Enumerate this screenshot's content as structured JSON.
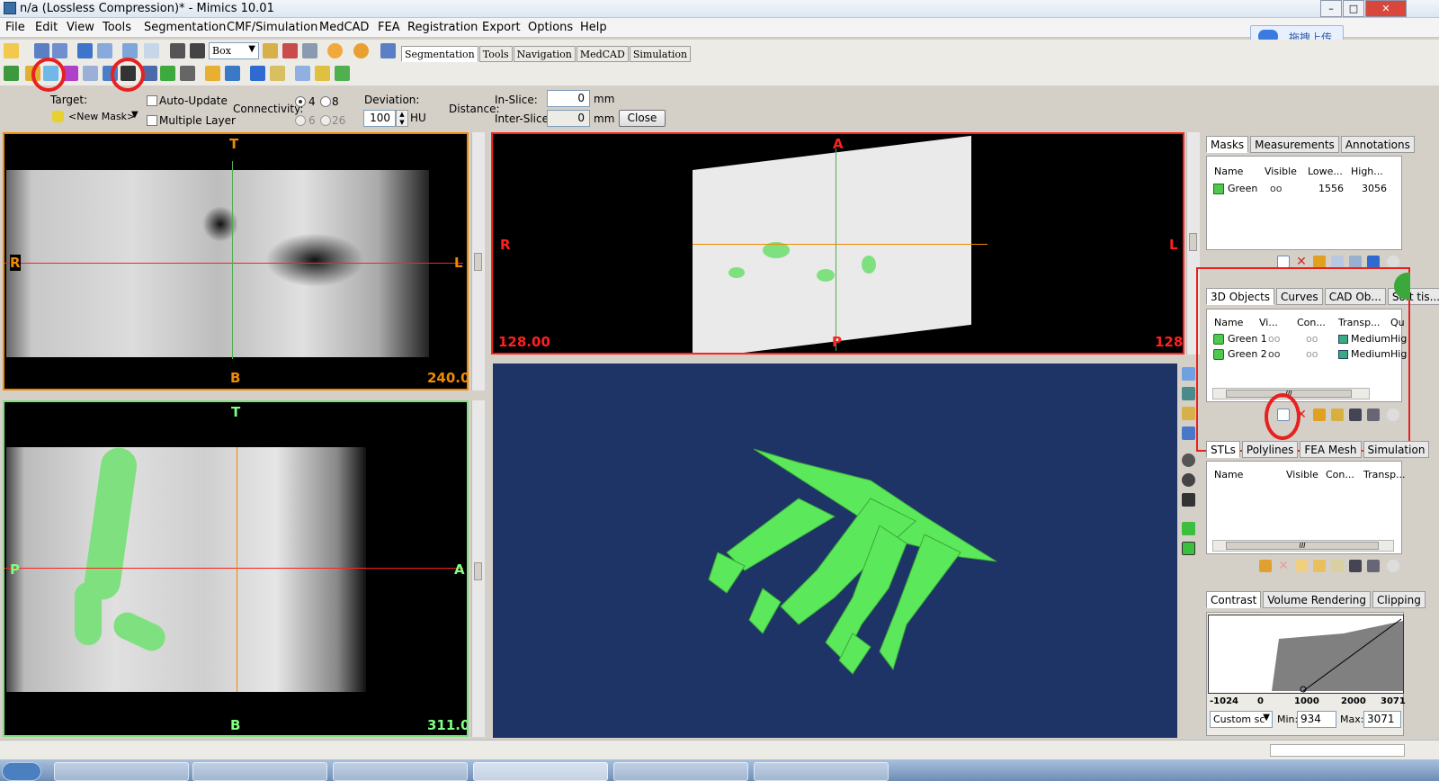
{
  "window": {
    "title": "n/a (Lossless Compression)* - Mimics  10.01"
  },
  "menu": [
    "File",
    "Edit",
    "View",
    "Tools",
    "Segmentation",
    "CMF/Simulation",
    "MedCAD",
    "FEA",
    "Registration",
    "Export",
    "Options",
    "Help"
  ],
  "upload_button": "拖拽上传",
  "toolbar": {
    "box_combo": "Box",
    "tabs": [
      "Segmentation",
      "Tools",
      "Navigation",
      "MedCAD",
      "Simulation"
    ],
    "active_tab": "Segmentation"
  },
  "options": {
    "target_label": "Target:",
    "target_value": "<New Mask>",
    "auto_update": "Auto-Update",
    "multiple_layer": "Multiple Layer",
    "connectivity_label": "Connectivity:",
    "conn_options": [
      "4",
      "8",
      "6",
      "26"
    ],
    "deviation_label": "Deviation:",
    "deviation_value": "100",
    "deviation_unit": "HU",
    "distance_label": "Distance:",
    "in_slice_label": "In-Slice:",
    "in_slice_value": "0",
    "inter_slice_label": "Inter-Slice:",
    "inter_slice_value": "0",
    "mm": "mm",
    "close": "Close"
  },
  "views": {
    "coronal": {
      "top": "T",
      "bottom": "B",
      "left": "R",
      "right": "L",
      "value": "240.0"
    },
    "sagittal": {
      "top": "T",
      "bottom": "B",
      "left": "P",
      "right": "A",
      "value": "311.0"
    },
    "axial": {
      "top": "A",
      "bottom": "P",
      "left": "R",
      "right": "L",
      "value_left": "128.00",
      "value_right": "128"
    }
  },
  "masks_panel": {
    "tabs": [
      "Masks",
      "Measurements",
      "Annotations"
    ],
    "headers": [
      "Name",
      "Visible",
      "Lowe...",
      "High..."
    ],
    "rows": [
      {
        "name": "Green",
        "low": "1556",
        "high": "3056"
      }
    ]
  },
  "objects_panel": {
    "tabs": [
      "3D Objects",
      "Curves",
      "CAD Ob...",
      "Soft tis..."
    ],
    "headers": [
      "Name",
      "Vi...",
      "Con...",
      "Transp...",
      "Qu"
    ],
    "rows": [
      {
        "name": "Green 1",
        "transp": "Medium",
        "q": "Hig"
      },
      {
        "name": "Green 2",
        "transp": "Medium",
        "q": "Hig"
      }
    ],
    "scroll_grip": "III"
  },
  "stl_panel": {
    "tabs": [
      "STLs",
      "Polylines",
      "FEA Mesh",
      "Simulation"
    ],
    "headers": [
      "Name",
      "Visible",
      "Con...",
      "Transp..."
    ],
    "scroll_grip": "III"
  },
  "contrast_panel": {
    "tabs": [
      "Contrast",
      "Volume Rendering",
      "Clipping"
    ],
    "axis": [
      "-1024",
      "0",
      "1000",
      "2000",
      "3071"
    ],
    "preset": "Custom sc",
    "min_label": "Min:",
    "min_value": "934",
    "max_label": "Max:",
    "max_value": "3071"
  },
  "colors": {
    "mask_green": "#4ec94e",
    "view_3d_bg": "#1e3466",
    "highlight_red": "#e8201f",
    "orange": "#f08a00"
  }
}
